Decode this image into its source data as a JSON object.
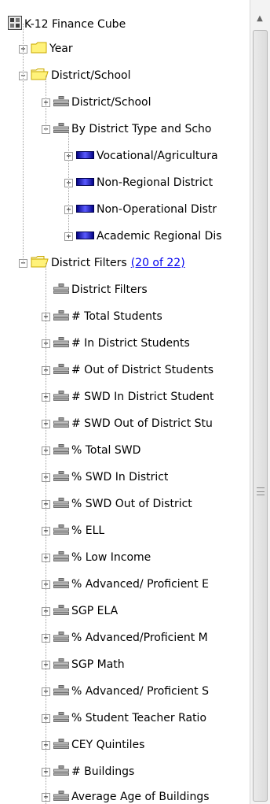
{
  "tree": {
    "rows": [
      {
        "label": "K-12 Finance Cube",
        "icon": "cube-icon",
        "level": 0,
        "toggle": null
      },
      {
        "label": "Year",
        "icon": "folder-closed-icon",
        "level": 1,
        "toggle": "+"
      },
      {
        "label": "District/School",
        "icon": "folder-open-icon",
        "level": 1,
        "toggle": "−"
      },
      {
        "label": "District/School",
        "icon": "dimension-icon",
        "level": 2,
        "toggle": "+"
      },
      {
        "label": "By District Type and Scho",
        "icon": "dimension-icon",
        "level": 2,
        "toggle": "−"
      },
      {
        "label": "Vocational/Agricultura",
        "icon": "level-icon",
        "level": 3,
        "toggle": "+"
      },
      {
        "label": "Non-Regional District",
        "icon": "level-icon",
        "level": 3,
        "toggle": "+"
      },
      {
        "label": "Non-Operational Distr",
        "icon": "level-icon",
        "level": 3,
        "toggle": "+"
      },
      {
        "label": "Academic Regional Dis",
        "icon": "level-icon",
        "level": 3,
        "toggle": "+"
      },
      {
        "label": "District Filters",
        "link": "(20 of 22)",
        "icon": "folder-open-icon",
        "level": 1,
        "toggle": "−"
      },
      {
        "label": "District Filters",
        "icon": "dimension-icon",
        "level": 2,
        "toggle": null
      },
      {
        "label": "# Total Students",
        "icon": "dimension-icon",
        "level": 2,
        "toggle": "+"
      },
      {
        "label": "# In District Students",
        "icon": "dimension-icon",
        "level": 2,
        "toggle": "+"
      },
      {
        "label": "# Out of District Students",
        "icon": "dimension-icon",
        "level": 2,
        "toggle": "+"
      },
      {
        "label": "# SWD In District Student",
        "icon": "dimension-icon",
        "level": 2,
        "toggle": "+"
      },
      {
        "label": "# SWD Out of District Stu",
        "icon": "dimension-icon",
        "level": 2,
        "toggle": "+"
      },
      {
        "label": "% Total SWD",
        "icon": "dimension-icon",
        "level": 2,
        "toggle": "+"
      },
      {
        "label": "% SWD In District",
        "icon": "dimension-icon",
        "level": 2,
        "toggle": "+"
      },
      {
        "label": "% SWD Out of District",
        "icon": "dimension-icon",
        "level": 2,
        "toggle": "+"
      },
      {
        "label": "% ELL",
        "icon": "dimension-icon",
        "level": 2,
        "toggle": "+"
      },
      {
        "label": "% Low Income",
        "icon": "dimension-icon",
        "level": 2,
        "toggle": "+"
      },
      {
        "label": "% Advanced/ Proficient E",
        "icon": "dimension-icon",
        "level": 2,
        "toggle": "+"
      },
      {
        "label": "SGP ELA",
        "icon": "dimension-icon",
        "level": 2,
        "toggle": "+"
      },
      {
        "label": "% Advanced/Proficient M",
        "icon": "dimension-icon",
        "level": 2,
        "toggle": "+"
      },
      {
        "label": "SGP Math",
        "icon": "dimension-icon",
        "level": 2,
        "toggle": "+"
      },
      {
        "label": "% Advanced/ Proficient S",
        "icon": "dimension-icon",
        "level": 2,
        "toggle": "+"
      },
      {
        "label": "% Student Teacher Ratio",
        "icon": "dimension-icon",
        "level": 2,
        "toggle": "+"
      },
      {
        "label": "CEY Quintiles",
        "icon": "dimension-icon",
        "level": 2,
        "toggle": "+"
      },
      {
        "label": "# Buildings",
        "icon": "dimension-icon",
        "level": 2,
        "toggle": "+"
      },
      {
        "label": "Average Age of Buildings",
        "icon": "dimension-icon",
        "level": 2,
        "toggle": "+"
      }
    ]
  },
  "scrollbar": {
    "up_arrow": "▲",
    "scroll_position": 0.0
  },
  "colors": {
    "link": "#0000ee",
    "folder": "#fff27a",
    "folder_border": "#c9a800",
    "level": "#3333cc"
  }
}
